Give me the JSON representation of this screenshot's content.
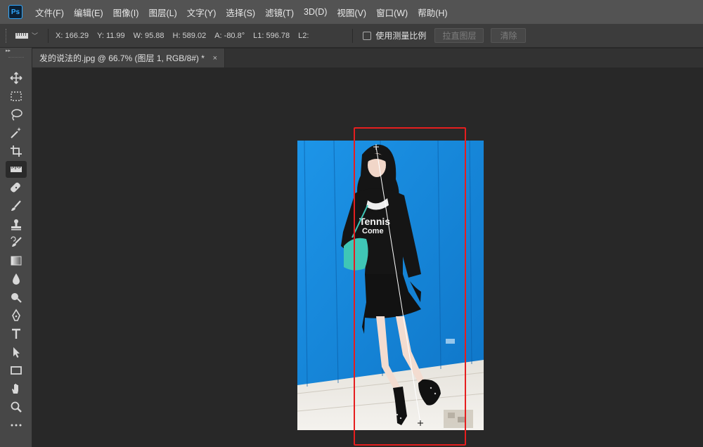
{
  "app": {
    "logo_text": "Ps"
  },
  "menu": [
    "文件(F)",
    "编辑(E)",
    "图像(I)",
    "图层(L)",
    "文字(Y)",
    "选择(S)",
    "滤镜(T)",
    "3D(D)",
    "视图(V)",
    "窗口(W)",
    "帮助(H)"
  ],
  "options": {
    "x": "X: 166.29",
    "y": "Y: 11.99",
    "w": "W: 95.88",
    "h": "H: 589.02",
    "a": "A: -80.8°",
    "l1": "L1: 596.78",
    "l2": "L2:",
    "use_measurement_scale": "使用测量比例",
    "straighten_layer": "拉直图层",
    "clear": "清除"
  },
  "document": {
    "tab_title": "发的说法的.jpg @ 66.7% (图层 1, RGB/8#) *",
    "close_glyph": "×"
  },
  "tools": [
    "move-icon",
    "marquee-icon",
    "lasso-icon",
    "magic-wand-icon",
    "crop-icon",
    "ruler-icon",
    "healing-brush-icon",
    "brush-icon",
    "stamp-icon",
    "history-brush-icon",
    "gradient-icon",
    "blur-icon",
    "dodge-icon",
    "pen-icon",
    "type-icon",
    "path-select-icon",
    "rectangle-icon",
    "hand-icon",
    "zoom-icon",
    "more-icon"
  ],
  "image_text": {
    "shirt_line1": "Tennis",
    "shirt_line2": "Come"
  },
  "colors": {
    "accent_red": "#e61e1e",
    "background_blue": "#1a8ee0",
    "ps_blue": "#31a8ff"
  }
}
